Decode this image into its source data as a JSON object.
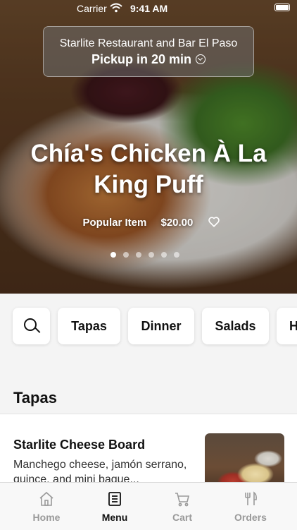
{
  "status_bar": {
    "carrier": "Carrier",
    "time": "9:41 AM"
  },
  "pickup": {
    "restaurant": "Starlite Restaurant and Bar El Paso",
    "time": "Pickup in 20 min"
  },
  "featured": {
    "title": "Chía's Chicken À La King Puff",
    "tag": "Popular Item",
    "price": "$20.00",
    "carousel": {
      "total": 6,
      "active": 1
    }
  },
  "categories": {
    "search_icon": "search-icon",
    "items": [
      "Tapas",
      "Dinner",
      "Salads",
      "H"
    ]
  },
  "section": {
    "title": "Tapas"
  },
  "menu_item": {
    "name": "Starlite Cheese Board",
    "description": "Manchego cheese, jamón serrano, quince, and mini bague..."
  },
  "tabbar": {
    "active": "Menu",
    "tabs": [
      {
        "label": "Home",
        "icon": "home-icon"
      },
      {
        "label": "Menu",
        "icon": "menu-list-icon"
      },
      {
        "label": "Cart",
        "icon": "cart-icon"
      },
      {
        "label": "Orders",
        "icon": "fork-knife-icon"
      }
    ]
  },
  "colors": {
    "text": "#111111",
    "muted": "#9a9a9a",
    "background": "#f4f4f4"
  }
}
